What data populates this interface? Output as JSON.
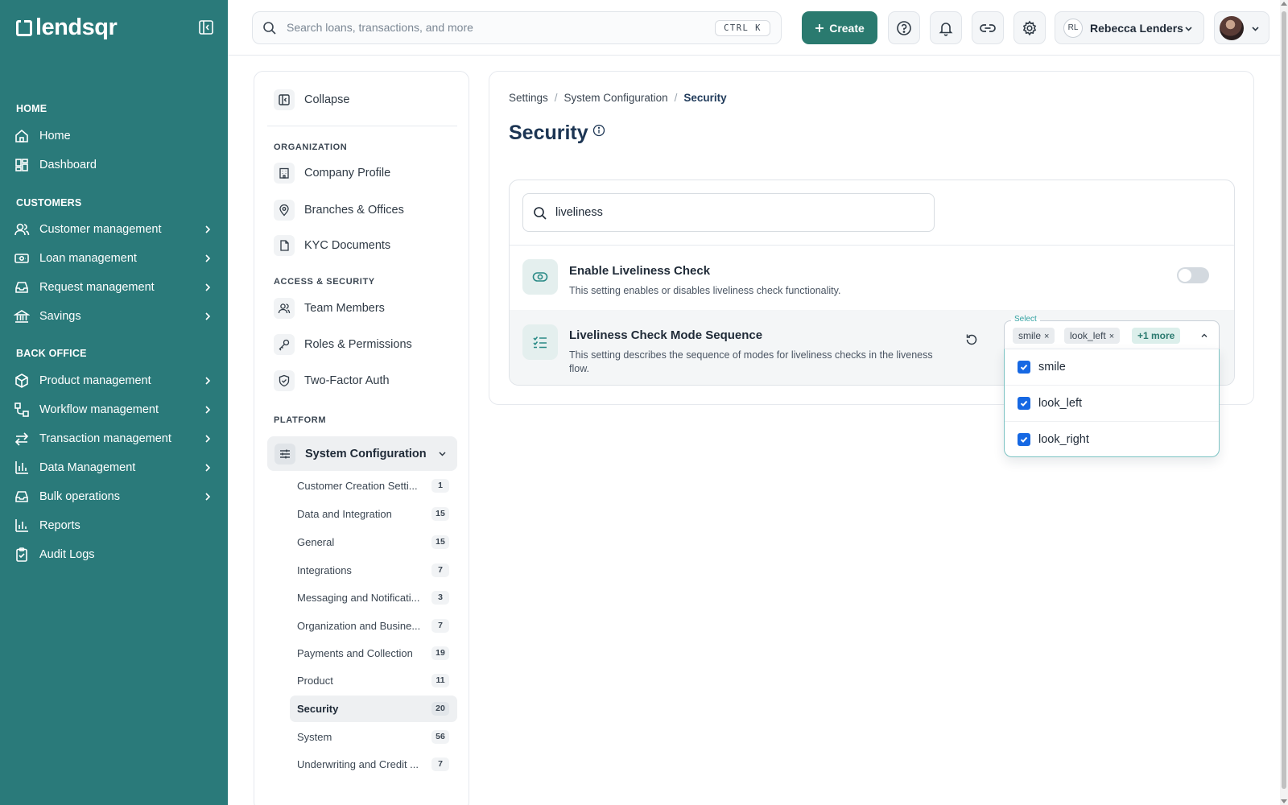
{
  "brand": {
    "name": "lendsqr"
  },
  "nav": {
    "sections": [
      {
        "title": "HOME",
        "items": [
          {
            "label": "Home"
          },
          {
            "label": "Dashboard"
          }
        ]
      },
      {
        "title": "CUSTOMERS",
        "items": [
          {
            "label": "Customer management"
          },
          {
            "label": "Loan management"
          },
          {
            "label": "Request management"
          },
          {
            "label": "Savings"
          }
        ]
      },
      {
        "title": "BACK OFFICE",
        "items": [
          {
            "label": "Product management"
          },
          {
            "label": "Workflow management"
          },
          {
            "label": "Transaction management"
          },
          {
            "label": "Data Management"
          },
          {
            "label": "Bulk operations"
          },
          {
            "label": "Reports"
          },
          {
            "label": "Audit Logs"
          }
        ]
      }
    ]
  },
  "topbar": {
    "search_placeholder": "Search loans, transactions, and more",
    "shortcut": "CTRL K",
    "create_label": "Create",
    "user_initials": "RL",
    "user_name": "Rebecca Lenders"
  },
  "settings_nav": {
    "collapse_label": "Collapse",
    "groups": [
      {
        "title": "ORGANIZATION",
        "items": [
          {
            "label": "Company Profile"
          },
          {
            "label": "Branches & Offices"
          },
          {
            "label": "KYC Documents"
          }
        ]
      },
      {
        "title": "ACCESS & SECURITY",
        "items": [
          {
            "label": "Team Members"
          },
          {
            "label": "Roles & Permissions"
          },
          {
            "label": "Two-Factor Auth"
          }
        ]
      },
      {
        "title": "PLATFORM",
        "items": [
          {
            "label": "System Configuration"
          }
        ]
      }
    ],
    "sub_items": [
      {
        "label": "Customer Creation Setti...",
        "count": "1"
      },
      {
        "label": "Data and Integration",
        "count": "15"
      },
      {
        "label": "General",
        "count": "15"
      },
      {
        "label": "Integrations",
        "count": "7"
      },
      {
        "label": "Messaging and Notificati...",
        "count": "3"
      },
      {
        "label": "Organization and Busine...",
        "count": "7"
      },
      {
        "label": "Payments and Collection",
        "count": "19"
      },
      {
        "label": "Product",
        "count": "11"
      },
      {
        "label": "Security",
        "count": "20"
      },
      {
        "label": "System",
        "count": "56"
      },
      {
        "label": "Underwriting and Credit ...",
        "count": "7"
      }
    ]
  },
  "content": {
    "breadcrumb": [
      "Settings",
      "System Configuration",
      "Security"
    ],
    "breadcrumb_sep": "/",
    "title": "Security",
    "filter_value": "liveliness",
    "settings": [
      {
        "title": "Enable Liveliness Check",
        "description": "This setting enables or disables liveliness check functionality.",
        "enabled": false
      },
      {
        "title": "Liveliness Check Mode Sequence",
        "description": "This setting describes the sequence of modes for liveliness checks in the liveness flow."
      }
    ],
    "multiselect": {
      "legend": "Select",
      "chips": [
        "smile",
        "look_left"
      ],
      "chip_remove": "×",
      "more_label": "+1 more",
      "options": [
        {
          "label": "smile",
          "checked": true
        },
        {
          "label": "look_left",
          "checked": true
        },
        {
          "label": "look_right",
          "checked": true
        }
      ]
    }
  },
  "colors": {
    "nav_bg": "#2a7a7a",
    "accent": "#2a7a6f",
    "checkbox": "#1668e3",
    "title": "#1c3553"
  }
}
